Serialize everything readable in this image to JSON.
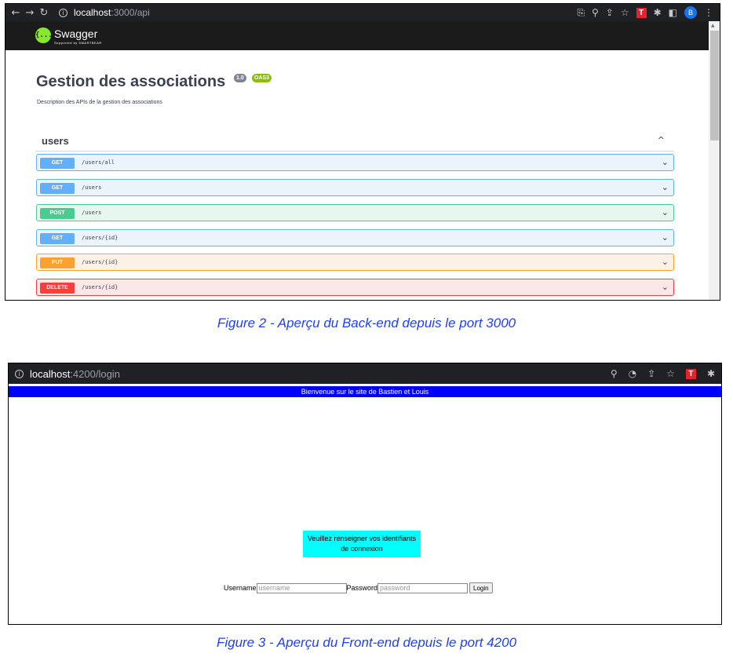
{
  "figure2": {
    "browser": {
      "url_host": "localhost",
      "url_rest": ":3000/api",
      "info_glyph": "i"
    },
    "swagger": {
      "logo_glyph": "{...}",
      "brand": "Swagger",
      "brand_sub": "Supported by SMARTBEAR"
    },
    "api": {
      "title": "Gestion des associations",
      "version": "1.0",
      "oas": "OAS3",
      "description": "Description des APIs de la gestion des associations"
    },
    "tag": {
      "name": "users",
      "chevron": "^"
    },
    "operations": [
      {
        "method": "GET",
        "path": "/users/all",
        "chevron": "⌄"
      },
      {
        "method": "GET",
        "path": "/users",
        "chevron": "⌄"
      },
      {
        "method": "POST",
        "path": "/users",
        "chevron": "⌄"
      },
      {
        "method": "GET",
        "path": "/users/{id}",
        "chevron": "⌄"
      },
      {
        "method": "PUT",
        "path": "/users/{id}",
        "chevron": "⌄"
      },
      {
        "method": "DELETE",
        "path": "/users/{id}",
        "chevron": "⌄"
      }
    ],
    "caption": "Figure 2 - Aperçu du Back-end depuis le port 3000"
  },
  "figure3": {
    "browser": {
      "url_host": "localhost",
      "url_rest": ":4200/login",
      "info_glyph": "i"
    },
    "welcome": "Bienvenue sur le site de Bastien et Louis",
    "login_message": "Veuillez renseigner vos identifiants de connexion",
    "form": {
      "username_label": "Username",
      "username_placeholder": "username",
      "password_label": "Password",
      "password_placeholder": "password",
      "login_button": "Login"
    },
    "caption": "Figure 3 - Aperçu du Front-end depuis le port 4200"
  },
  "colors": {
    "get": "#61affe",
    "post": "#49cc90",
    "put": "#fca130",
    "delete": "#f93e3e",
    "caption": "#1f3fff",
    "welcome_bar": "#0000ff",
    "login_box": "#00ffff"
  }
}
